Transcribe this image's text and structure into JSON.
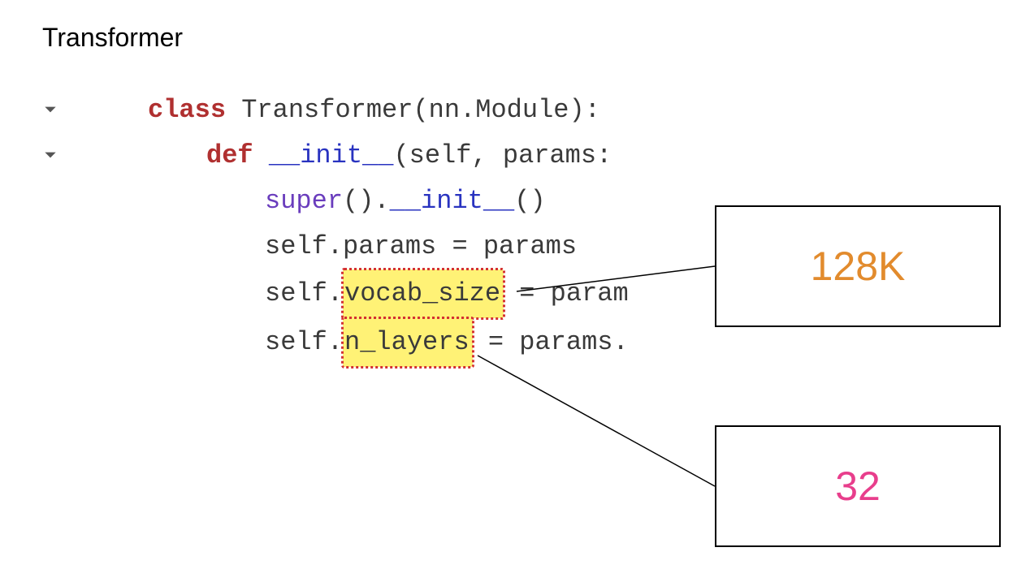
{
  "title": "Transformer",
  "code": {
    "line1": {
      "kw": "class",
      "name": " Transformer(nn.Module):"
    },
    "line2": {
      "kw": "def",
      "name": " __init__",
      "sig": "(self, params:"
    },
    "line3": {
      "builtin": "super",
      "call": "().",
      "method": "__init__",
      "tail": "()"
    },
    "line4": "self.params = params",
    "line5": {
      "pre": "self.",
      "hl": "vocab_size",
      "post": " = param"
    },
    "line6": {
      "pre": "self.",
      "hl": "n_layers",
      "post": " = params."
    }
  },
  "callout1": "128K",
  "callout2": "32",
  "values": {
    "vocab_size": "128K",
    "n_layers": 32
  }
}
